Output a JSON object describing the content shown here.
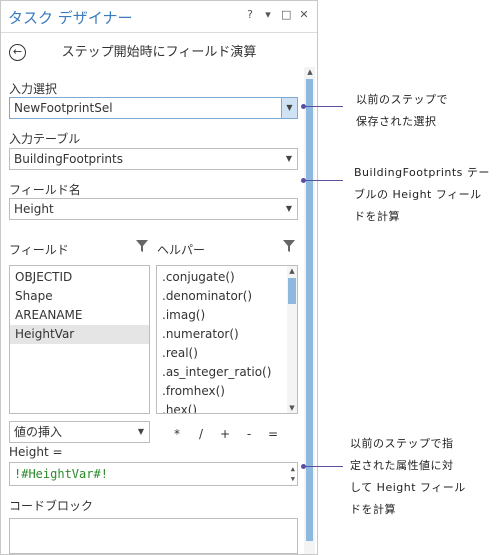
{
  "pane": {
    "title": "タスク デザイナー",
    "header_buttons": [
      "?",
      "▾",
      "□",
      "✕"
    ]
  },
  "step": {
    "title": "ステップ開始時にフィールド演算"
  },
  "input_selection": {
    "label": "入力選択",
    "value": "NewFootprintSel"
  },
  "input_table": {
    "label": "入力テーブル",
    "value": "BuildingFootprints"
  },
  "field_name": {
    "label": "フィールド名",
    "value": "Height"
  },
  "fields_panel": {
    "label": "フィールド",
    "items": [
      "OBJECTID",
      "Shape",
      "AREANAME",
      "HeightVar"
    ],
    "selected": "HeightVar"
  },
  "helpers_panel": {
    "label": "ヘルパー",
    "items": [
      ".conjugate()",
      ".denominator()",
      ".imag()",
      ".numerator()",
      ".real()",
      ".as_integer_ratio()",
      ".fromhex()",
      ".hex()"
    ]
  },
  "insert_values": {
    "label": "値の挿入"
  },
  "operators": [
    "*",
    "/",
    "+",
    "-",
    "="
  ],
  "expression": {
    "label": "Height =",
    "value": "!#HeightVar#!"
  },
  "code_block": {
    "label": "コードブロック"
  },
  "callouts": [
    {
      "lines": [
        "以前のステップで",
        "保存された選択"
      ]
    },
    {
      "lines": [
        "BuildingFootprints テー",
        "ブルの Height フィール",
        "ドを計算"
      ]
    },
    {
      "lines": [
        "以前のステップで指",
        "定された属性値に対",
        "して Height フィール",
        "ドを計算"
      ]
    }
  ],
  "colors": {
    "title_blue": "#3a7bbf",
    "callout_line": "#5a4fa0",
    "scroll_thumb": "#8fb8de",
    "expression_text": "#2a8a2a"
  }
}
